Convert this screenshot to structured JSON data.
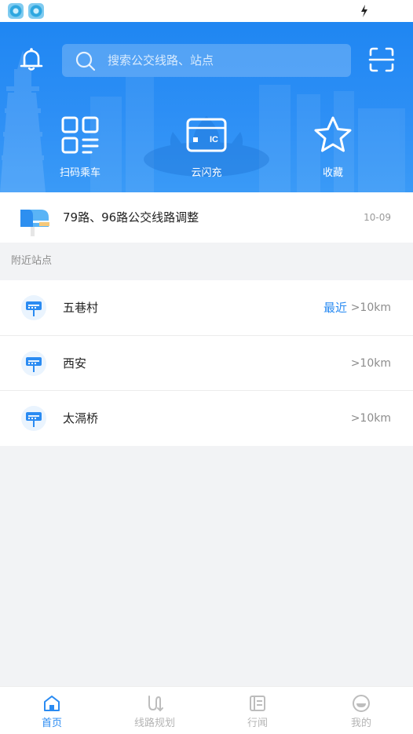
{
  "status_bar": {
    "app_icons": [
      "app-icon",
      "app-icon"
    ],
    "charging_icon": "lightning-bolt-icon"
  },
  "header": {
    "search_placeholder": "搜索公交线路、站点",
    "left_icon": "bell-icon",
    "right_icon": "scan-icon",
    "quick_actions": [
      {
        "label": "扫码乘车",
        "icon": "qr-code-icon"
      },
      {
        "label": "云闪充",
        "icon": "ic-card-icon",
        "card_text": "IC"
      },
      {
        "label": "收藏",
        "icon": "star-icon"
      }
    ],
    "accent_color": "#2a8bf2"
  },
  "notice": {
    "text": "79路、96路公交线路调整",
    "date": "10-09",
    "icon": "mailbox-icon"
  },
  "nearby": {
    "title": "附近站点",
    "stations": [
      {
        "name": "五巷村",
        "tag": "最近",
        "distance": ">10km"
      },
      {
        "name": "西安",
        "tag": "",
        "distance": ">10km"
      },
      {
        "name": "太滆桥",
        "tag": "",
        "distance": ">10km"
      }
    ]
  },
  "tabbar": {
    "tabs": [
      {
        "label": "首页",
        "icon": "home-icon",
        "active": true
      },
      {
        "label": "线路规划",
        "icon": "route-icon",
        "active": false
      },
      {
        "label": "行闻",
        "icon": "news-icon",
        "active": false
      },
      {
        "label": "我的",
        "icon": "profile-icon",
        "active": false
      }
    ]
  }
}
